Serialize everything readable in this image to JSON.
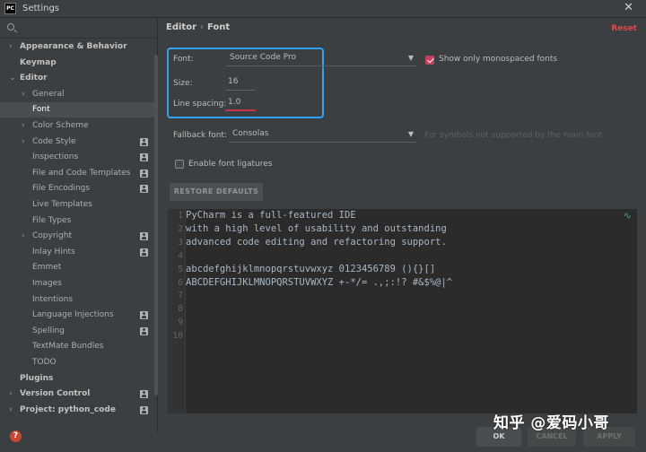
{
  "window": {
    "title": "Settings",
    "app_icon_text": "PC"
  },
  "sidebar": {
    "items": [
      {
        "label": "Appearance & Behavior",
        "level": 0,
        "arrow": "›",
        "bold": true
      },
      {
        "label": "Keymap",
        "level": 0,
        "arrow": "",
        "bold": true
      },
      {
        "label": "Editor",
        "level": 0,
        "arrow": "⌄",
        "bold": true
      },
      {
        "label": "General",
        "level": 1,
        "arrow": "›"
      },
      {
        "label": "Font",
        "level": 1,
        "arrow": "",
        "selected": true
      },
      {
        "label": "Color Scheme",
        "level": 1,
        "arrow": "›"
      },
      {
        "label": "Code Style",
        "level": 1,
        "arrow": "›",
        "project": true
      },
      {
        "label": "Inspections",
        "level": 1,
        "arrow": "",
        "project": true
      },
      {
        "label": "File and Code Templates",
        "level": 1,
        "arrow": "",
        "project": true
      },
      {
        "label": "File Encodings",
        "level": 1,
        "arrow": "",
        "project": true
      },
      {
        "label": "Live Templates",
        "level": 1,
        "arrow": ""
      },
      {
        "label": "File Types",
        "level": 1,
        "arrow": ""
      },
      {
        "label": "Copyright",
        "level": 1,
        "arrow": "›",
        "project": true
      },
      {
        "label": "Inlay Hints",
        "level": 1,
        "arrow": "",
        "project": true
      },
      {
        "label": "Emmet",
        "level": 1,
        "arrow": ""
      },
      {
        "label": "Images",
        "level": 1,
        "arrow": ""
      },
      {
        "label": "Intentions",
        "level": 1,
        "arrow": ""
      },
      {
        "label": "Language Injections",
        "level": 1,
        "arrow": "",
        "project": true
      },
      {
        "label": "Spelling",
        "level": 1,
        "arrow": "",
        "project": true
      },
      {
        "label": "TextMate Bundles",
        "level": 1,
        "arrow": ""
      },
      {
        "label": "TODO",
        "level": 1,
        "arrow": ""
      },
      {
        "label": "Plugins",
        "level": 0,
        "arrow": "",
        "bold": true
      },
      {
        "label": "Version Control",
        "level": 0,
        "arrow": "›",
        "bold": true,
        "project": true
      },
      {
        "label": "Project: python_code",
        "level": 0,
        "arrow": "›",
        "bold": true,
        "project": true
      }
    ]
  },
  "header": {
    "crumb1": "Editor",
    "separator": "›",
    "crumb2": "Font",
    "reset": "Reset"
  },
  "font_settings": {
    "font_label": "Font:",
    "font_value": "Source Code Pro",
    "size_label": "Size:",
    "size_value": "16",
    "line_spacing_label": "Line spacing:",
    "line_spacing_value": "1.0",
    "monospace_only_label": "Show only monospaced fonts",
    "monospace_only_checked": true,
    "fallback_label": "Fallback font:",
    "fallback_value": "Consolas",
    "fallback_hint": "For symbols not supported by the main font",
    "ligatures_label": "Enable font ligatures",
    "ligatures_checked": false,
    "restore_button": "RESTORE DEFAULTS"
  },
  "preview": {
    "lines": [
      "PyCharm is a full-featured IDE",
      "with a high level of usability and outstanding",
      "advanced code editing and refactoring support.",
      "",
      "abcdefghijklmnopqrstuvwxyz 0123456789 (){}[]",
      "ABCDEFGHIJKLMNOPQRSTUVWXYZ +-*/= .,;:!? #&$%@|^",
      "",
      "",
      "",
      ""
    ],
    "line_numbers": [
      "1",
      "2",
      "3",
      "4",
      "5",
      "6",
      "7",
      "8",
      "9",
      "10"
    ]
  },
  "buttons": {
    "ok": "OK",
    "cancel": "CANCEL",
    "apply": "APPLY"
  },
  "watermark": "知乎 @爱码小哥",
  "colors": {
    "accent_blue": "#2ea3f2",
    "reset_red": "#e0474c",
    "checkbox_pink": "#c7405c"
  }
}
